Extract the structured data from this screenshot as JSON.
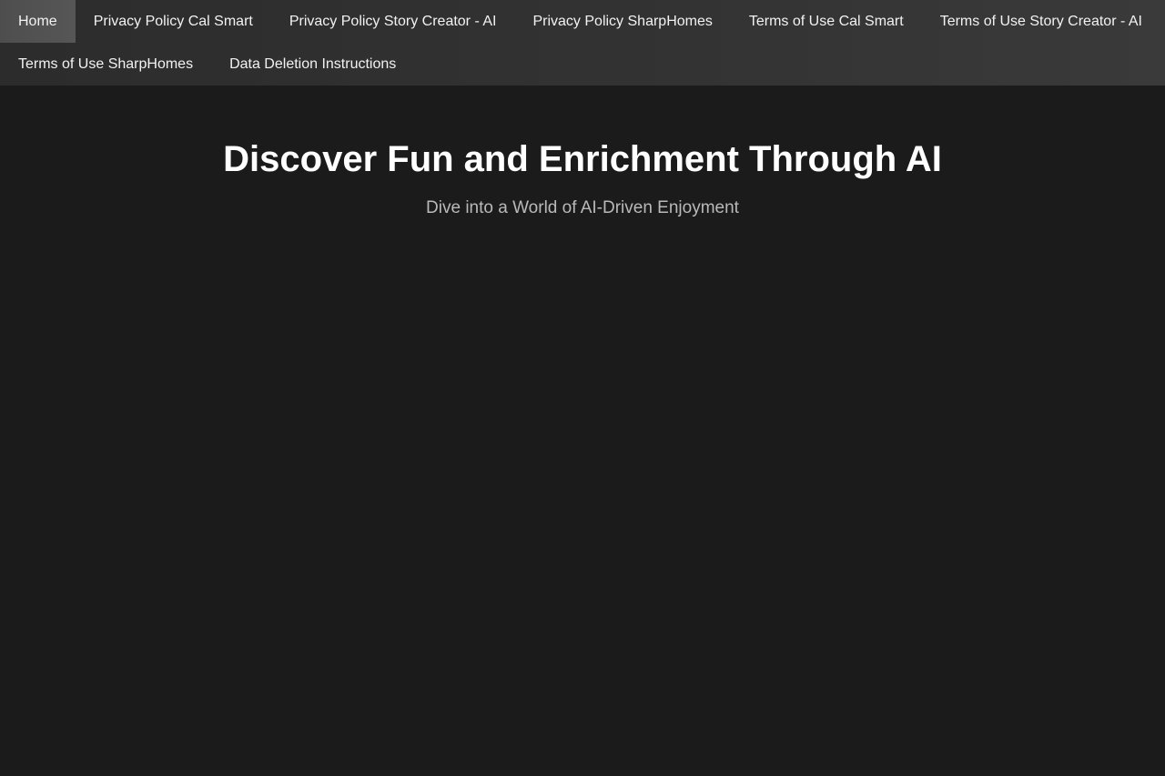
{
  "nav": {
    "items": [
      {
        "label": "Home",
        "active": true
      },
      {
        "label": "Privacy Policy Cal Smart"
      },
      {
        "label": "Privacy Policy Story Creator - AI"
      },
      {
        "label": "Privacy Policy SharpHomes"
      },
      {
        "label": "Terms of Use Cal Smart"
      },
      {
        "label": "Terms of Use Story Creator - AI"
      },
      {
        "label": "Terms of Use SharpHomes"
      },
      {
        "label": "Data Deletion Instructions"
      }
    ]
  },
  "hero": {
    "title": "Discover Fun and Enrichment Through AI",
    "subtitle": "Dive into a World of AI-Driven Enjoyment"
  },
  "colors": {
    "background": "#1b1b1b",
    "nav_background": "#333333",
    "nav_active": "#555555",
    "title": "#ffffff",
    "subtitle": "#b9b9b9"
  }
}
